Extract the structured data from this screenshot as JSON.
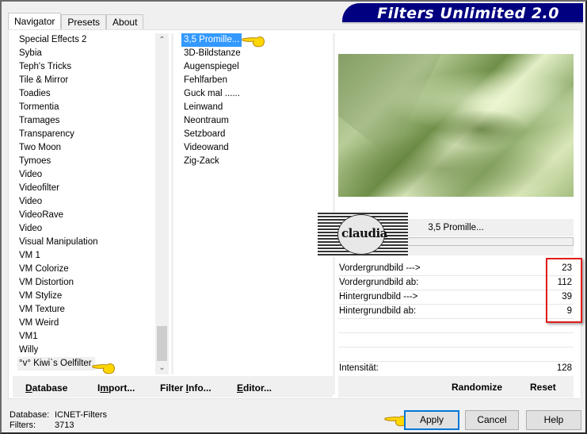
{
  "window": {
    "banner_title": "Filters Unlimited 2.0"
  },
  "tabs": [
    {
      "label": "Navigator",
      "active": true
    },
    {
      "label": "Presets",
      "active": false
    },
    {
      "label": "About",
      "active": false
    }
  ],
  "categories": {
    "items": [
      "Special Effects 2",
      "Sybia",
      "Teph's Tricks",
      "Tile & Mirror",
      "Toadies",
      "Tormentia",
      "Tramages",
      "Transparency",
      "Two Moon",
      "Tymoes",
      "Video",
      "Videofilter",
      "Video",
      "VideoRave",
      "Video",
      "Visual Manipulation",
      "VM 1",
      "VM Colorize",
      "VM Distortion",
      "VM Stylize",
      "VM Texture",
      "VM Weird",
      "VM1",
      "Willy",
      "°v° Kiwi`s Oelfilter"
    ],
    "selected": "°v° Kiwi`s Oelfilter",
    "scroll_up_icon": "▲",
    "scroll_down_icon": "▼"
  },
  "filters": {
    "items": [
      "3,5 Promille...",
      "3D-Bildstanze",
      "Augenspiegel",
      "Fehlfarben",
      "Guck mal ......",
      "Leinwand",
      "Neontraum",
      "Setzboard",
      "Videowand",
      "Zig-Zack"
    ],
    "selected": "3,5 Promille..."
  },
  "preview": {
    "filter_name": "3,5 Promille...",
    "logo_text": "claudia"
  },
  "parameters": [
    {
      "label": "Vordergrundbild --->",
      "value": "23"
    },
    {
      "label": "Vordergrundbild ab:",
      "value": "112"
    },
    {
      "label": "Hintergrundbild --->",
      "value": "39"
    },
    {
      "label": "Hintergrundbild ab:",
      "value": "9"
    }
  ],
  "intensity": {
    "label": "Intensität:",
    "value": "128"
  },
  "right_buttons": {
    "randomize": "Randomize",
    "reset": "Reset"
  },
  "left_buttons": {
    "database": {
      "pre": "",
      "u": "D",
      "post": "atabase"
    },
    "import": {
      "pre": "I",
      "u": "m",
      "post": "port..."
    },
    "filter_info": {
      "pre": "Filter ",
      "u": "I",
      "post": "nfo..."
    },
    "editor": {
      "pre": "",
      "u": "E",
      "post": "ditor..."
    }
  },
  "status": {
    "database_label": "Database:",
    "database_value": "ICNET-Filters",
    "filters_label": "Filters:",
    "filters_value": "3713"
  },
  "dialog_buttons": {
    "apply": "Apply",
    "cancel": "Cancel",
    "help": "Help"
  },
  "colors": {
    "banner": "#000080",
    "selection": "#3399ff",
    "highlight_box": "#e31b1b",
    "default_button_border": "#0078d7"
  }
}
